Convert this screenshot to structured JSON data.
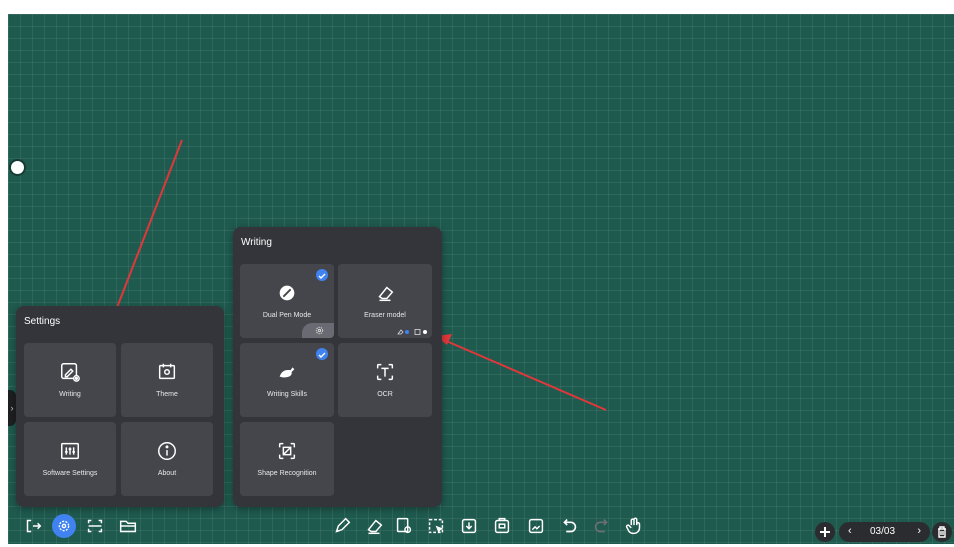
{
  "settings_panel": {
    "title": "Settings",
    "items": [
      {
        "label": "Writing",
        "icon": "pen-settings-icon"
      },
      {
        "label": "Theme",
        "icon": "theme-icon"
      },
      {
        "label": "Software Settings",
        "icon": "sliders-icon"
      },
      {
        "label": "About",
        "icon": "info-icon"
      }
    ]
  },
  "writing_panel": {
    "title": "Writing",
    "items": [
      {
        "label": "Dual Pen Mode",
        "icon": "dual-pen-icon",
        "checked": true
      },
      {
        "label": "Eraser model",
        "icon": "eraser-icon",
        "checked": false
      },
      {
        "label": "Writing Skills",
        "icon": "writing-skills-icon",
        "checked": true
      },
      {
        "label": "OCR",
        "icon": "ocr-icon",
        "checked": false
      },
      {
        "label": "Shape Recognition",
        "icon": "shape-recognition-icon",
        "checked": false
      }
    ]
  },
  "pagination": {
    "label": "03/03"
  },
  "colors": {
    "accent": "#3f82f0",
    "board": "#1f5a4f",
    "panel": "#34353a",
    "tile": "#45464c",
    "arrow": "#e0383a"
  }
}
